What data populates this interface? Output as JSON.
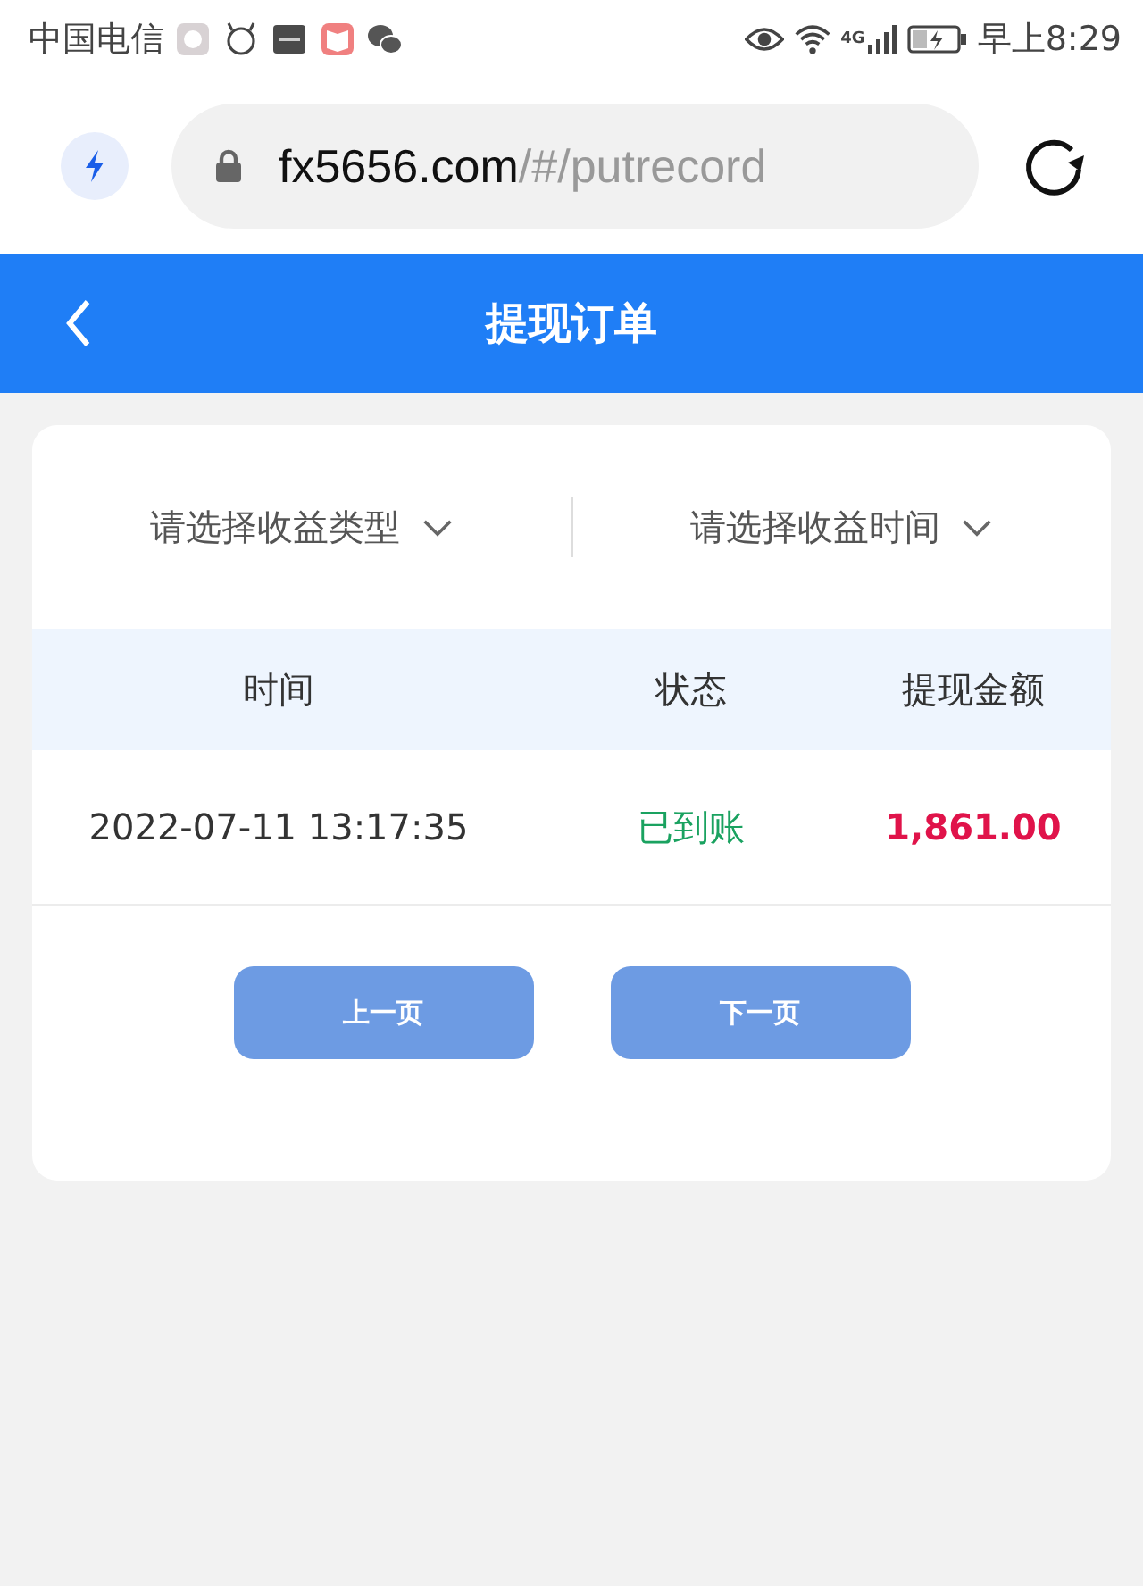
{
  "status_bar": {
    "carrier": "中国电信",
    "network": "4G",
    "time": "早上8:29"
  },
  "browser": {
    "url_domain": "fx5656.com",
    "url_path": "/#/putrecord"
  },
  "header": {
    "title": "提现订单"
  },
  "filters": [
    {
      "placeholder": "请选择收益类型"
    },
    {
      "placeholder": "请选择收益时间"
    }
  ],
  "table": {
    "columns": [
      "时间",
      "状态",
      "提现金额"
    ],
    "rows": [
      {
        "time": "2022-07-11 13:17:35",
        "status": "已到账",
        "amount": "1,861.00"
      }
    ]
  },
  "pager": [
    {
      "label": "上一页",
      "disabled": true
    },
    {
      "label": "下一页",
      "disabled": true
    }
  ]
}
